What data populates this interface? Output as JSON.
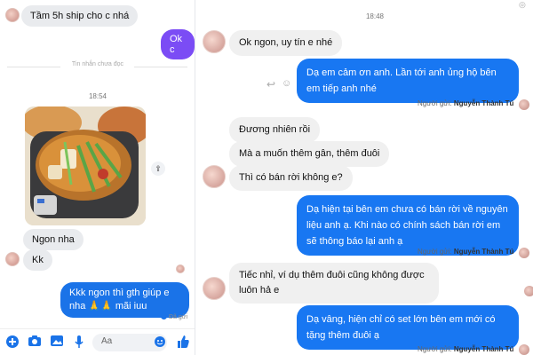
{
  "left": {
    "msg_top": "Tầm 5h ship cho c nhá",
    "reply_ok": "Ok c",
    "unread_divider": "Tin nhắn chưa đọc",
    "time_1": "18:54",
    "msg_ngon": "Ngon nha",
    "msg_kk": "Kk",
    "msg_out": "Kkk ngon thì gth giúp e nha 🙏🙏 mãi iuu",
    "seen_label": "Đã gửi",
    "compose_placeholder": "Aa",
    "icons": [
      "plus-circle-icon",
      "camera-icon",
      "image-icon",
      "mic-icon",
      "emoji-icon",
      "like-icon",
      "share-icon"
    ]
  },
  "right": {
    "time_top": "18:48",
    "m1": "Ok ngon, uy tín e nhé",
    "m2": "Dạ em cảm ơn anh. Lần tới anh ủng hộ bên em tiếp anh nhé",
    "m3": "Đương nhiên rồi",
    "m4": "Mà a muốn thêm gân, thêm đuôi",
    "m5": "Thì có bán rời không e?",
    "m6": "Dạ hiện tại bên em chưa có bán rời về nguyên liệu anh ạ. Khi nào có chính sách bán rời em sẽ thông báo lại anh ạ",
    "m7": "Tiếc nhỉ, ví dụ thêm đuôi cũng không được luôn hả e",
    "m8": "Dạ vâng, hiện chỉ có set lớn bên em mới có tặng thêm đuôi ạ",
    "sender_prefix": "Người gửi:",
    "sender_name": "Nguyễn Thành Tú"
  },
  "colors": {
    "blue": "#1877f2",
    "purple": "#7b4cf5",
    "gray_bubble": "#f0f0f0"
  }
}
